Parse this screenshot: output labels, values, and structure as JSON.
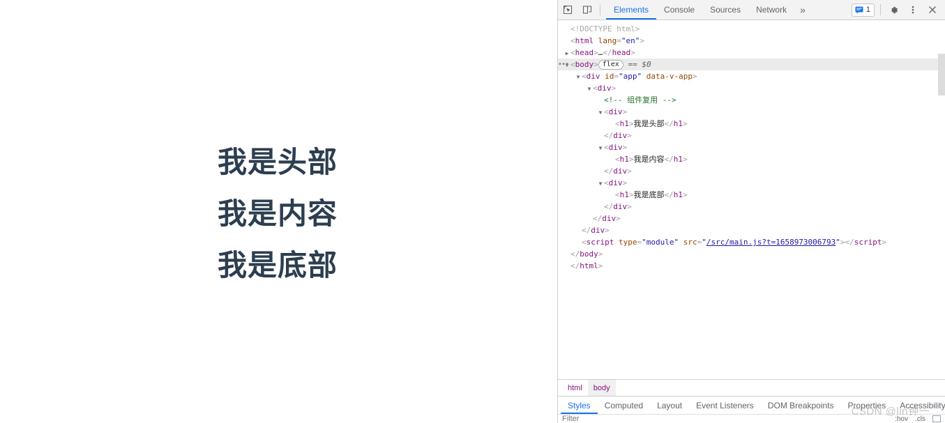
{
  "page": {
    "headings": [
      {
        "text": "我是头部"
      },
      {
        "text": "我是内容"
      },
      {
        "text": "我是底部"
      }
    ],
    "heading_color": "#2c3e50",
    "background": "#ffffff"
  },
  "devtools": {
    "toolbar": {
      "inspect_icon": "inspect-element-icon",
      "device_icon": "device-toolbar-icon",
      "tabs": [
        {
          "label": "Elements",
          "active": true
        },
        {
          "label": "Console",
          "active": false
        },
        {
          "label": "Sources",
          "active": false
        },
        {
          "label": "Network",
          "active": false
        }
      ],
      "more_tabs": "»",
      "message_count": "1",
      "message_icon": "console-message-icon",
      "settings_icon": "gear-icon",
      "menu_icon": "kebab-menu-icon",
      "close_icon": "close-icon"
    },
    "accent_color": "#1a73e8",
    "tree": [
      {
        "indent": 1,
        "arrow": "none",
        "parts": [
          {
            "c": "doctype",
            "t": "<!DOCTYPE html>"
          }
        ]
      },
      {
        "indent": 1,
        "arrow": "none",
        "parts": [
          {
            "c": "punc",
            "t": "<"
          },
          {
            "c": "tw",
            "t": "html"
          },
          {
            "c": "attr-n",
            "t": " lang"
          },
          {
            "c": "punc",
            "t": "="
          },
          {
            "c": "attr-v",
            "t": "\"en\""
          },
          {
            "c": "punc",
            "t": ">"
          }
        ]
      },
      {
        "indent": 1,
        "arrow": "closed",
        "parts": [
          {
            "c": "punc",
            "t": "<"
          },
          {
            "c": "tw",
            "t": "head"
          },
          {
            "c": "punc",
            "t": ">"
          },
          {
            "c": "txt",
            "t": "…"
          },
          {
            "c": "punc",
            "t": "</"
          },
          {
            "c": "tw",
            "t": "head"
          },
          {
            "c": "punc",
            "t": ">"
          }
        ]
      },
      {
        "indent": 1,
        "arrow": "open",
        "selected": true,
        "dots": true,
        "parts": [
          {
            "c": "punc",
            "t": "<"
          },
          {
            "c": "tw",
            "t": "body"
          },
          {
            "c": "punc",
            "t": ">"
          },
          {
            "c": "badge",
            "t": "flex"
          },
          {
            "c": "eqd",
            "t": "  == $0"
          }
        ]
      },
      {
        "indent": 2,
        "arrow": "open",
        "parts": [
          {
            "c": "punc",
            "t": "<"
          },
          {
            "c": "tw",
            "t": "div"
          },
          {
            "c": "attr-n",
            "t": " id"
          },
          {
            "c": "punc",
            "t": "="
          },
          {
            "c": "attr-v",
            "t": "\"app\""
          },
          {
            "c": "attr-n",
            "t": " data-v-app"
          },
          {
            "c": "punc",
            "t": ">"
          }
        ]
      },
      {
        "indent": 3,
        "arrow": "open",
        "parts": [
          {
            "c": "punc",
            "t": "<"
          },
          {
            "c": "tw",
            "t": "div"
          },
          {
            "c": "punc",
            "t": ">"
          }
        ]
      },
      {
        "indent": 4,
        "arrow": "none",
        "parts": [
          {
            "c": "comment",
            "t": "<!-- 组件复用 -->"
          }
        ]
      },
      {
        "indent": 4,
        "arrow": "open",
        "parts": [
          {
            "c": "punc",
            "t": "<"
          },
          {
            "c": "tw",
            "t": "div"
          },
          {
            "c": "punc",
            "t": ">"
          }
        ]
      },
      {
        "indent": 5,
        "arrow": "none",
        "parts": [
          {
            "c": "punc",
            "t": "<"
          },
          {
            "c": "tw",
            "t": "h1"
          },
          {
            "c": "punc",
            "t": ">"
          },
          {
            "c": "txt",
            "t": "我是头部"
          },
          {
            "c": "punc",
            "t": "</"
          },
          {
            "c": "tw",
            "t": "h1"
          },
          {
            "c": "punc",
            "t": ">"
          }
        ]
      },
      {
        "indent": 4,
        "arrow": "none",
        "parts": [
          {
            "c": "punc",
            "t": "</"
          },
          {
            "c": "tw",
            "t": "div"
          },
          {
            "c": "punc",
            "t": ">"
          }
        ]
      },
      {
        "indent": 4,
        "arrow": "open",
        "parts": [
          {
            "c": "punc",
            "t": "<"
          },
          {
            "c": "tw",
            "t": "div"
          },
          {
            "c": "punc",
            "t": ">"
          }
        ]
      },
      {
        "indent": 5,
        "arrow": "none",
        "parts": [
          {
            "c": "punc",
            "t": "<"
          },
          {
            "c": "tw",
            "t": "h1"
          },
          {
            "c": "punc",
            "t": ">"
          },
          {
            "c": "txt",
            "t": "我是内容"
          },
          {
            "c": "punc",
            "t": "</"
          },
          {
            "c": "tw",
            "t": "h1"
          },
          {
            "c": "punc",
            "t": ">"
          }
        ]
      },
      {
        "indent": 4,
        "arrow": "none",
        "parts": [
          {
            "c": "punc",
            "t": "</"
          },
          {
            "c": "tw",
            "t": "div"
          },
          {
            "c": "punc",
            "t": ">"
          }
        ]
      },
      {
        "indent": 4,
        "arrow": "open",
        "parts": [
          {
            "c": "punc",
            "t": "<"
          },
          {
            "c": "tw",
            "t": "div"
          },
          {
            "c": "punc",
            "t": ">"
          }
        ]
      },
      {
        "indent": 5,
        "arrow": "none",
        "parts": [
          {
            "c": "punc",
            "t": "<"
          },
          {
            "c": "tw",
            "t": "h1"
          },
          {
            "c": "punc",
            "t": ">"
          },
          {
            "c": "txt",
            "t": "我是底部"
          },
          {
            "c": "punc",
            "t": "</"
          },
          {
            "c": "tw",
            "t": "h1"
          },
          {
            "c": "punc",
            "t": ">"
          }
        ]
      },
      {
        "indent": 4,
        "arrow": "none",
        "parts": [
          {
            "c": "punc",
            "t": "</"
          },
          {
            "c": "tw",
            "t": "div"
          },
          {
            "c": "punc",
            "t": ">"
          }
        ]
      },
      {
        "indent": 3,
        "arrow": "none",
        "parts": [
          {
            "c": "punc",
            "t": "</"
          },
          {
            "c": "tw",
            "t": "div"
          },
          {
            "c": "punc",
            "t": ">"
          }
        ]
      },
      {
        "indent": 2,
        "arrow": "none",
        "parts": [
          {
            "c": "punc",
            "t": "</"
          },
          {
            "c": "tw",
            "t": "div"
          },
          {
            "c": "punc",
            "t": ">"
          }
        ]
      },
      {
        "indent": 2,
        "arrow": "none",
        "parts": [
          {
            "c": "punc",
            "t": "<"
          },
          {
            "c": "tw",
            "t": "script"
          },
          {
            "c": "attr-n",
            "t": " type"
          },
          {
            "c": "punc",
            "t": "="
          },
          {
            "c": "attr-v",
            "t": "\"module\""
          },
          {
            "c": "attr-n",
            "t": " src"
          },
          {
            "c": "punc",
            "t": "="
          },
          {
            "c": "attr-v",
            "t": "\""
          },
          {
            "c": "link",
            "t": "/src/main.js?t=1658973006793"
          },
          {
            "c": "attr-v",
            "t": "\""
          },
          {
            "c": "punc",
            "t": ">"
          },
          {
            "c": "punc",
            "t": "</"
          },
          {
            "c": "tw",
            "t": "script"
          },
          {
            "c": "punc",
            "t": ">"
          }
        ]
      },
      {
        "indent": 1,
        "arrow": "none",
        "parts": [
          {
            "c": "punc",
            "t": "</"
          },
          {
            "c": "tw",
            "t": "body"
          },
          {
            "c": "punc",
            "t": ">"
          }
        ]
      },
      {
        "indent": 0,
        "arrow": "none",
        "parts": [
          {
            "c": "punc",
            "t": "</"
          },
          {
            "c": "tw",
            "t": "html"
          },
          {
            "c": "punc",
            "t": ">"
          }
        ]
      }
    ],
    "breadcrumb": [
      {
        "label": "html",
        "active": false
      },
      {
        "label": "body",
        "active": true
      }
    ],
    "subtabs": [
      {
        "label": "Styles",
        "active": true
      },
      {
        "label": "Computed",
        "active": false
      },
      {
        "label": "Layout",
        "active": false
      },
      {
        "label": "Event Listeners",
        "active": false
      },
      {
        "label": "DOM Breakpoints",
        "active": false
      },
      {
        "label": "Properties",
        "active": false
      },
      {
        "label": "Accessibility",
        "active": false
      }
    ],
    "styles_filter": {
      "placeholder": "Filter",
      "hov_label": ":hov",
      "cls_label": ".cls"
    }
  },
  "watermark": "CSDN @lin钟一"
}
